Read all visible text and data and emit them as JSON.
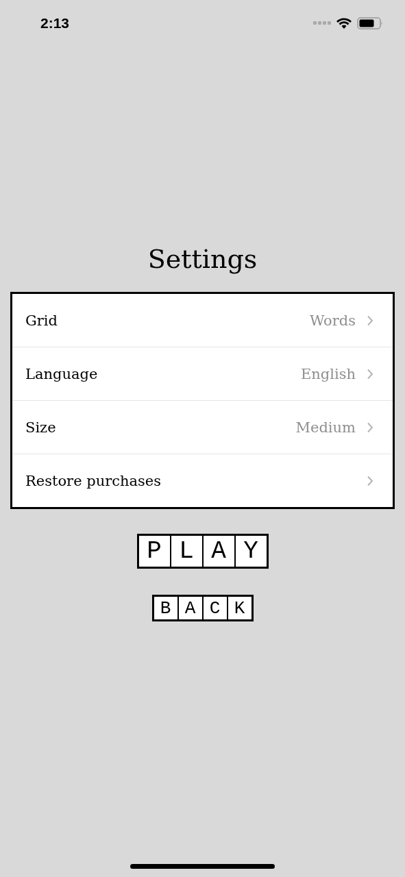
{
  "status_bar": {
    "time": "2:13"
  },
  "title": "Settings",
  "settings": [
    {
      "label": "Grid",
      "value": "Words"
    },
    {
      "label": "Language",
      "value": "English"
    },
    {
      "label": "Size",
      "value": "Medium"
    },
    {
      "label": "Restore purchases"
    }
  ],
  "play_button": {
    "letters": [
      "P",
      "L",
      "A",
      "Y"
    ]
  },
  "back_button": {
    "letters": [
      "B",
      "A",
      "C",
      "K"
    ]
  }
}
